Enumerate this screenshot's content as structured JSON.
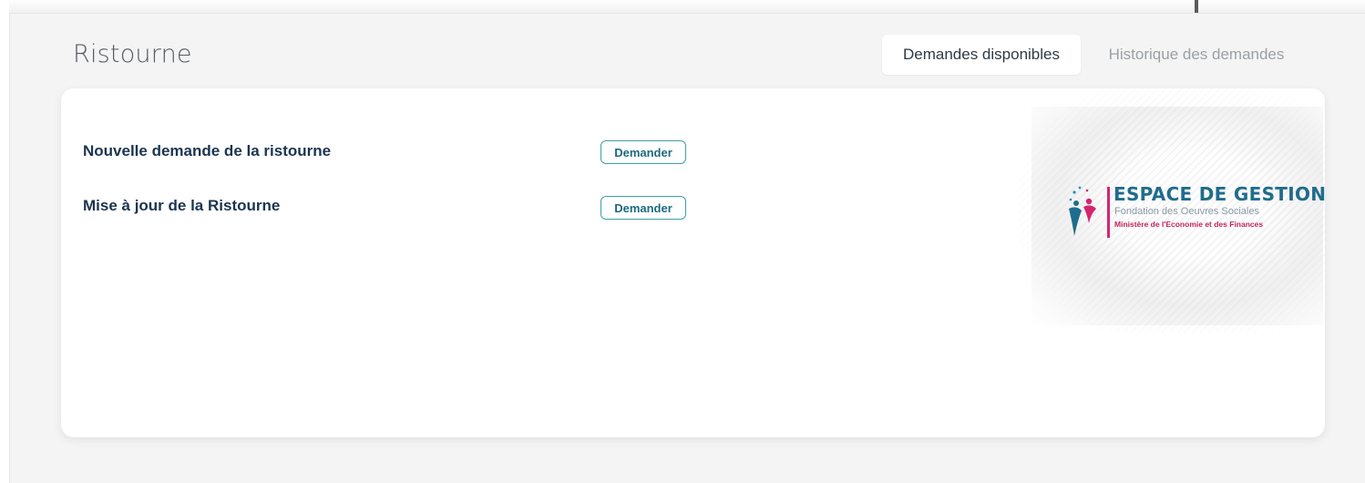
{
  "page": {
    "title": "Ristourne"
  },
  "tabs": [
    {
      "label": "Demandes disponibles",
      "active": true
    },
    {
      "label": "Historique des demandes",
      "active": false
    }
  ],
  "requests": [
    {
      "label": "Nouvelle demande de la ristourne",
      "button": "Demander"
    },
    {
      "label": "Mise à jour de la Ristourne",
      "button": "Demander"
    }
  ],
  "logo": {
    "title": "ESPACE DE GESTION",
    "subtitle": "Fondation des Oeuvres Sociales",
    "ministry": "Ministère de l'Economie et des Finances",
    "icon": "people-figures-icon"
  },
  "colors": {
    "accent": "#3ea0a3",
    "label_text": "#1b3550",
    "brand_blue": "#1f6c8e",
    "brand_pink": "#d6246e"
  }
}
